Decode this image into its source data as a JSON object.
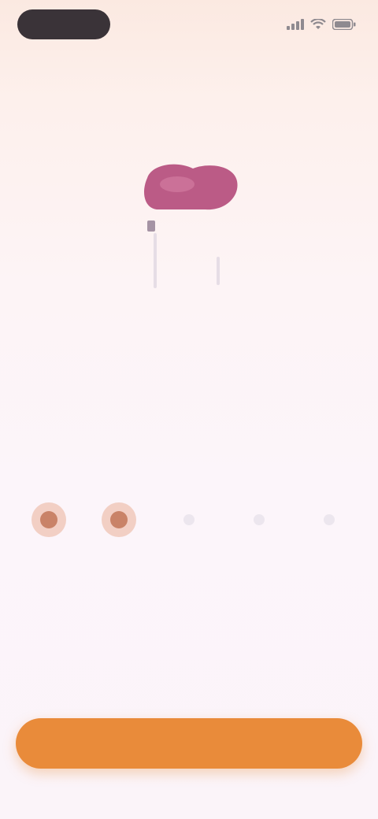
{
  "status_bar": {
    "time": "",
    "icons": [
      "signal-icon",
      "wifi-icon",
      "battery-icon"
    ]
  },
  "logo": {
    "name": "app-logo",
    "color": "#b44a7a"
  },
  "headline": "",
  "subheadline": "",
  "rating": {
    "selected_count": 2,
    "total": 5,
    "active_color": "#c98368",
    "inactive_color": "#ece6ee"
  },
  "description": "",
  "cta": {
    "label": "",
    "color": "#e98b3a"
  }
}
